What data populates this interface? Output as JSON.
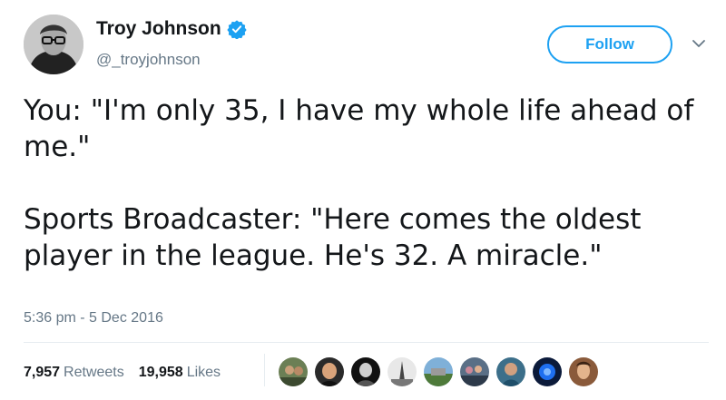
{
  "author": {
    "display_name": "Troy Johnson",
    "handle": "@_troyjohnson",
    "verified": true
  },
  "follow_button": {
    "label": "Follow"
  },
  "tweet": {
    "paragraphs": [
      "You: \"I'm only 35, I have my whole life ahead of me.\"",
      "Sports Broadcaster: \"Here comes the oldest player in the league. He's 32. A miracle.\""
    ],
    "timestamp": "5:36 pm - 5 Dec 2016"
  },
  "stats": {
    "retweets_count": "7,957",
    "retweets_label": "Retweets",
    "likes_count": "19,958",
    "likes_label": "Likes"
  },
  "colors": {
    "accent": "#1da1f2",
    "text": "#14171a",
    "muted": "#657786"
  },
  "icons": [
    "verified-badge-icon",
    "chevron-down-icon"
  ]
}
